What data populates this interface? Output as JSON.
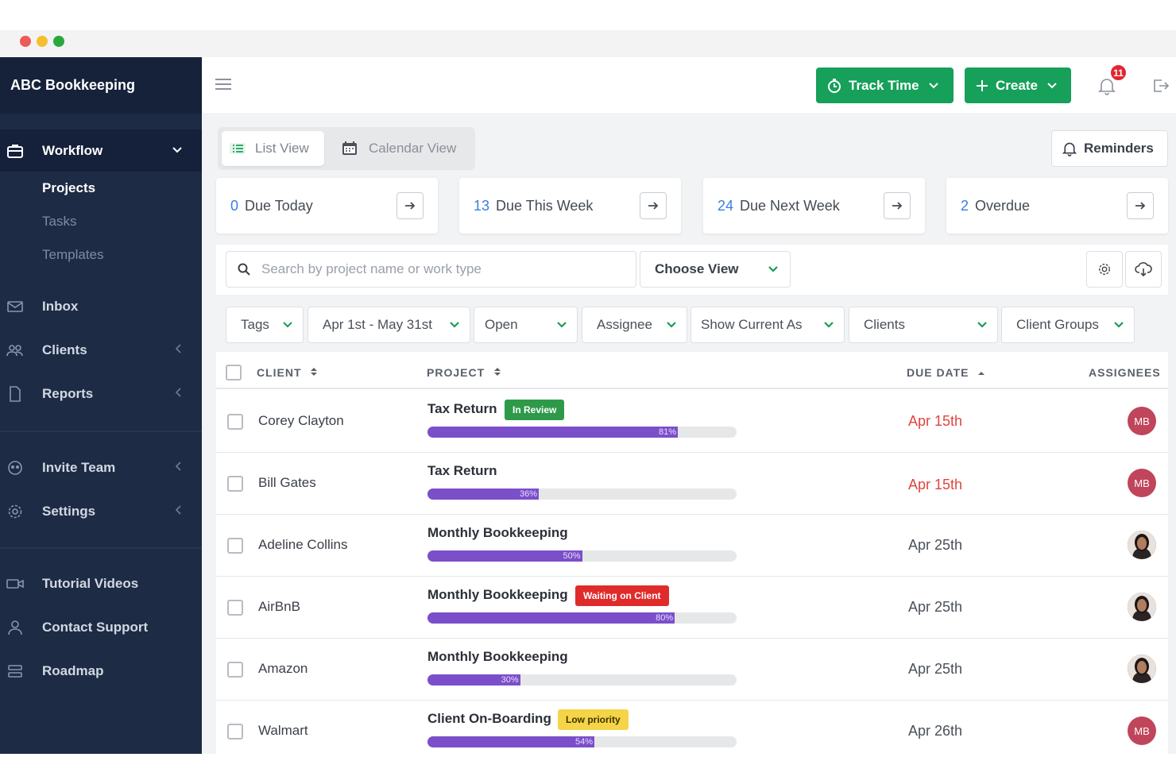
{
  "window": {
    "traffic_lights": [
      "close",
      "minimize",
      "zoom"
    ]
  },
  "sidebar": {
    "brand": "ABC Bookkeeping",
    "workflow": {
      "label": "Workflow",
      "icon": "briefcase-icon",
      "sub": [
        "Projects",
        "Tasks",
        "Templates"
      ]
    },
    "items": [
      {
        "label": "Inbox",
        "icon": "mail-icon"
      },
      {
        "label": "Clients",
        "icon": "users-icon"
      },
      {
        "label": "Reports",
        "icon": "document-icon"
      },
      {
        "label": "Invite Team",
        "icon": "team-icon"
      },
      {
        "label": "Settings",
        "icon": "gear-icon"
      },
      {
        "label": "Tutorial Videos",
        "icon": "video-icon"
      },
      {
        "label": "Contact Support",
        "icon": "person-icon"
      },
      {
        "label": "Roadmap",
        "icon": "roadmap-icon"
      }
    ]
  },
  "topbar": {
    "track_time": "Track Time",
    "create": "Create",
    "notification_count": "11"
  },
  "views": {
    "list": "List View",
    "calendar": "Calendar View",
    "reminders": "Reminders"
  },
  "due_cards": [
    {
      "count": "0",
      "label": "Due Today"
    },
    {
      "count": "13",
      "label": "Due This Week"
    },
    {
      "count": "24",
      "label": "Due Next Week"
    },
    {
      "count": "2",
      "label": "Overdue"
    }
  ],
  "search": {
    "placeholder": "Search by project name or work type"
  },
  "choose_view": "Choose View",
  "filters": [
    "Tags",
    "Apr 1st - May 31st",
    "Open",
    "Assignee",
    "Show Current As",
    "Clients",
    "Client Groups"
  ],
  "table": {
    "headers": {
      "client": "CLIENT",
      "project": "PROJECT",
      "due": "DUE DATE",
      "assignees": "ASSIGNEES"
    },
    "rows": [
      {
        "client": "Corey Clayton",
        "project": "Tax Return",
        "tag": "In Review",
        "progress": 81,
        "progress_label": "81%",
        "due": "Apr 15th",
        "overdue": true,
        "assignee": "MB"
      },
      {
        "client": "Bill Gates",
        "project": "Tax Return",
        "tag": "",
        "progress": 36,
        "progress_label": "36%",
        "due": "Apr 15th",
        "overdue": true,
        "assignee": "MB"
      },
      {
        "client": "Adeline Collins",
        "project": "Monthly Bookkeeping",
        "tag": "",
        "progress": 50,
        "progress_label": "50%",
        "due": "Apr 25th",
        "overdue": false,
        "assignee": "photo"
      },
      {
        "client": "AirBnB",
        "project": "Monthly Bookkeeping",
        "tag": "Waiting on Client",
        "progress": 80,
        "progress_label": "80%",
        "due": "Apr 25th",
        "overdue": false,
        "assignee": "photo"
      },
      {
        "client": "Amazon",
        "project": "Monthly Bookkeeping",
        "tag": "",
        "progress": 30,
        "progress_label": "30%",
        "due": "Apr 25th",
        "overdue": false,
        "assignee": "photo"
      },
      {
        "client": "Walmart",
        "project": "Client On-Boarding",
        "tag": "Low priority",
        "progress": 54,
        "progress_label": "54%",
        "due": "Apr 26th",
        "overdue": false,
        "assignee": "MB"
      }
    ]
  },
  "colors": {
    "primary_green": "#16a05a",
    "sidebar": "#1d2b45",
    "progress": "#7b4fc9",
    "overdue_red": "#e0453f",
    "link_blue": "#3b7de0",
    "tag_review": "#2e9a49",
    "tag_waiting": "#e02b2b",
    "tag_low": "#f5d547"
  }
}
